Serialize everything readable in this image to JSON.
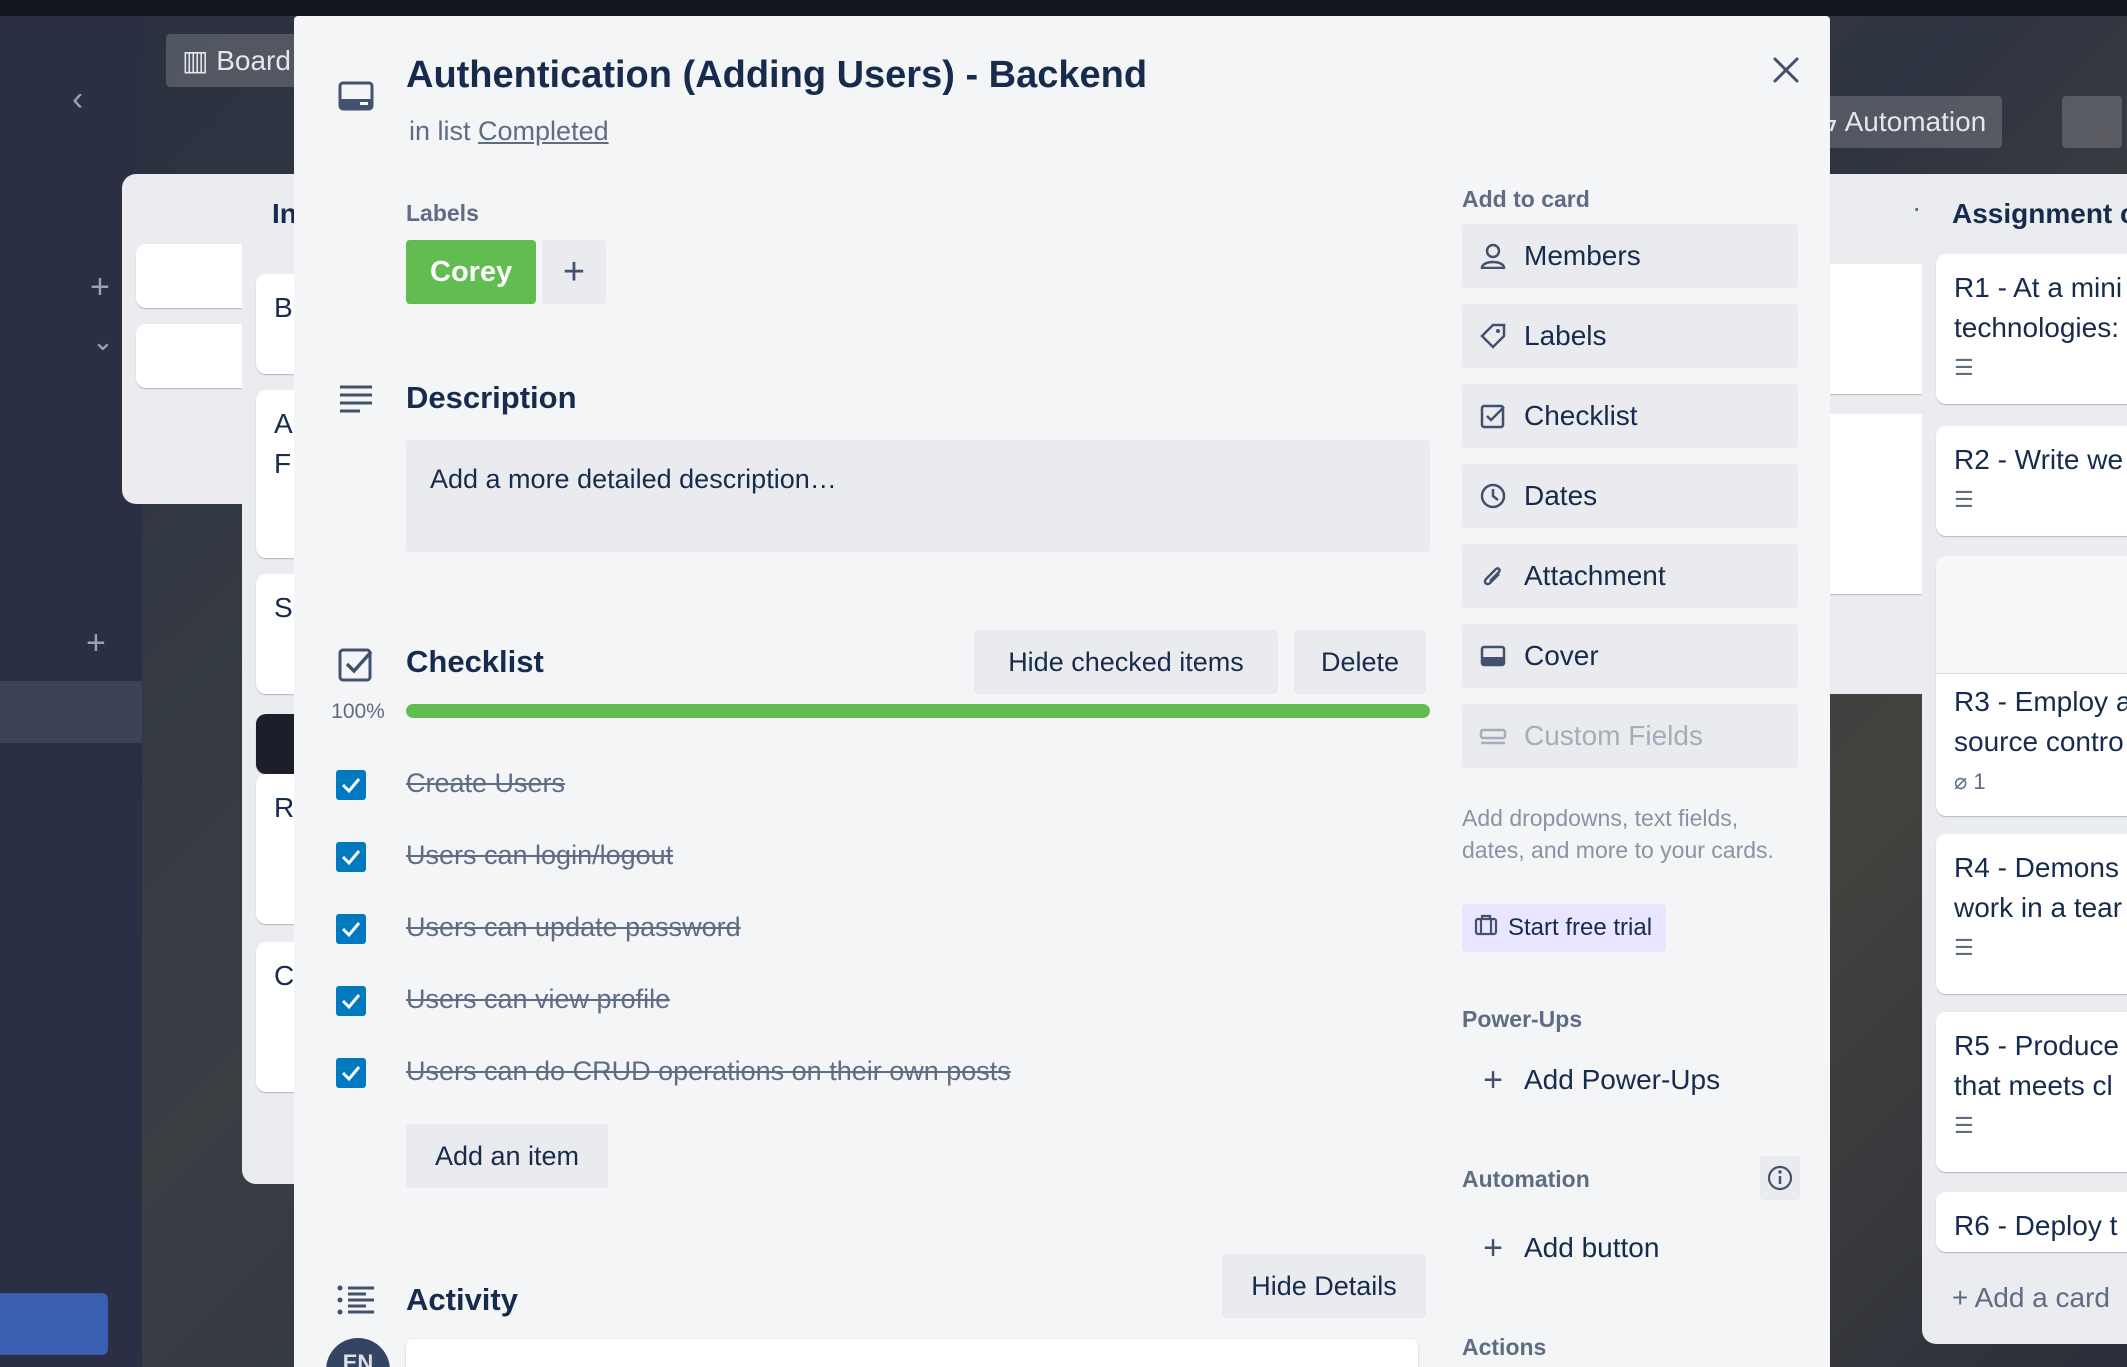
{
  "card": {
    "title": "Authentication (Adding Users) - Backend",
    "list_prefix": "in list",
    "list_name": "Completed"
  },
  "labels": {
    "heading": "Labels",
    "items": [
      {
        "name": "Corey",
        "color": "#61bd4f"
      }
    ],
    "add_symbol": "+"
  },
  "description": {
    "heading": "Description",
    "placeholder": "Add a more detailed description…"
  },
  "checklist": {
    "heading": "Checklist",
    "hide_checked_label": "Hide checked items",
    "delete_label": "Delete",
    "progress_text": "100%",
    "progress": 1.0,
    "items": [
      {
        "text": "Create Users",
        "checked": true
      },
      {
        "text": "Users can login/logout",
        "checked": true
      },
      {
        "text": "Users can update password",
        "checked": true
      },
      {
        "text": "Users can view profile",
        "checked": true
      },
      {
        "text": "Users can do CRUD operations on their own posts",
        "checked": true
      }
    ],
    "add_item_label": "Add an item"
  },
  "activity": {
    "heading": "Activity",
    "hide_details_label": "Hide Details",
    "avatar_initials": "EN"
  },
  "sidebar": {
    "add_to_card_heading": "Add to card",
    "buttons": [
      {
        "label": "Members",
        "icon": "person-icon"
      },
      {
        "label": "Labels",
        "icon": "tag-icon"
      },
      {
        "label": "Checklist",
        "icon": "checklist-icon"
      },
      {
        "label": "Dates",
        "icon": "clock-icon"
      },
      {
        "label": "Attachment",
        "icon": "paperclip-icon"
      },
      {
        "label": "Cover",
        "icon": "cover-icon"
      },
      {
        "label": "Custom Fields",
        "icon": "custom-fields-icon"
      }
    ],
    "custom_fields_note": "Add dropdowns, text fields, dates, and more to your cards.",
    "trial_label": "Start free trial",
    "powerups_heading": "Power-Ups",
    "add_powerups_label": "Add Power-Ups",
    "automation_heading": "Automation",
    "add_button_label": "Add button",
    "actions_heading": "Actions"
  },
  "background": {
    "board_chip": "Board",
    "automation_label": "Automation",
    "left_list_card_prefixes": [
      "B",
      "A",
      "F",
      "S",
      "R",
      "C"
    ],
    "right_list_title": "Assignment c",
    "right_cards": [
      "R1 - At a mini",
      "technologies:",
      "R2 - Write we",
      "R3 - Employ a",
      "source contro",
      "1",
      "R4 - Demons",
      "work in a tear",
      "R5 - Produce",
      "that meets cl",
      "R6 - Deploy t",
      "+ Add a card"
    ],
    "list_initial": "In"
  }
}
